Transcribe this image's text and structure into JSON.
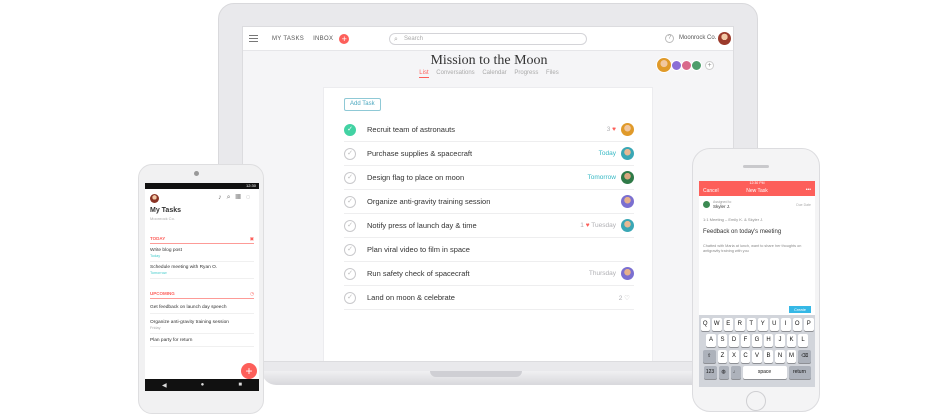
{
  "laptop": {
    "topbar": {
      "tab_my_tasks": "MY TASKS",
      "tab_inbox": "INBOX",
      "add_icon": "+",
      "search_placeholder": "Search",
      "help_icon": "?",
      "org_name": "Moonrock Co."
    },
    "project": {
      "title": "Mission to the Moon",
      "tabs": [
        "List",
        "Conversations",
        "Calendar",
        "Progress",
        "Files"
      ],
      "active_tab": "List",
      "add_member_icon": "+"
    },
    "add_task_label": "Add Task",
    "tasks": [
      {
        "name": "Recruit team of astronauts",
        "done": true,
        "likes": "3",
        "heart": "♥",
        "due": ""
      },
      {
        "name": "Purchase supplies & spacecraft",
        "done": false,
        "likes": "",
        "heart": "",
        "due": "Today"
      },
      {
        "name": "Design flag to place on moon",
        "done": false,
        "likes": "",
        "heart": "",
        "due": "Tomorrow"
      },
      {
        "name": "Organize anti-gravity training session",
        "done": false,
        "likes": "",
        "heart": "",
        "due": ""
      },
      {
        "name": "Notify press of launch day & time",
        "done": false,
        "likes": "1",
        "heart": "♥",
        "due": "Tuesday"
      },
      {
        "name": "Plan viral video to film in space",
        "done": false,
        "likes": "",
        "heart": "",
        "due": ""
      },
      {
        "name": "Run safety check of spacecraft",
        "done": false,
        "likes": "",
        "heart": "",
        "due": "Thursday"
      },
      {
        "name": "Land on moon & celebrate",
        "done": false,
        "likes": "2",
        "heart": "♡",
        "due": ""
      }
    ]
  },
  "android": {
    "status_time": "12:30",
    "title": "My Tasks",
    "subtitle": "Moonrock Co.",
    "section_today": "TODAY",
    "section_upcoming": "UPCOMING",
    "today_items": [
      {
        "name": "Write blog post",
        "due": "Today"
      },
      {
        "name": "Schedule meeting with Ryan O.",
        "due": "Tomorrow"
      }
    ],
    "upcoming_items": [
      {
        "name": "Get feedback on launch day speech",
        "due": ""
      },
      {
        "name": "Organize anti-gravity training session",
        "due": "Friday"
      },
      {
        "name": "Plan party for return",
        "due": ""
      }
    ],
    "fab_icon": "+",
    "nav_back": "◀",
    "nav_home": "●",
    "nav_recent": "■"
  },
  "iphone": {
    "status_time": "12:30 PM",
    "nav_cancel": "Cancel",
    "nav_title": "New Task",
    "nav_more": "•••",
    "assigned_label": "Assigned to",
    "assignee": "Skyler J.",
    "due_date": "Due Date",
    "project_line": "1:1 Meeting – Emily K. & Skyler J.",
    "task_name": "Feedback on today's meeting",
    "description": "Chatted with Maria at lunch, want to share her thoughts on antigravity training with you",
    "create_label": "Create",
    "keyboard": {
      "row1": [
        "Q",
        "W",
        "E",
        "R",
        "T",
        "Y",
        "U",
        "I",
        "O",
        "P"
      ],
      "row2": [
        "A",
        "S",
        "D",
        "F",
        "G",
        "H",
        "J",
        "K",
        "L"
      ],
      "row3": [
        "Z",
        "X",
        "C",
        "V",
        "B",
        "N",
        "M"
      ],
      "num_key": "123",
      "space_key": "space",
      "return_key": "return"
    }
  },
  "colors": {
    "brand_red": "#fd5f5a",
    "complete_green": "#42d2a3",
    "due_teal": "#35b8c4"
  }
}
